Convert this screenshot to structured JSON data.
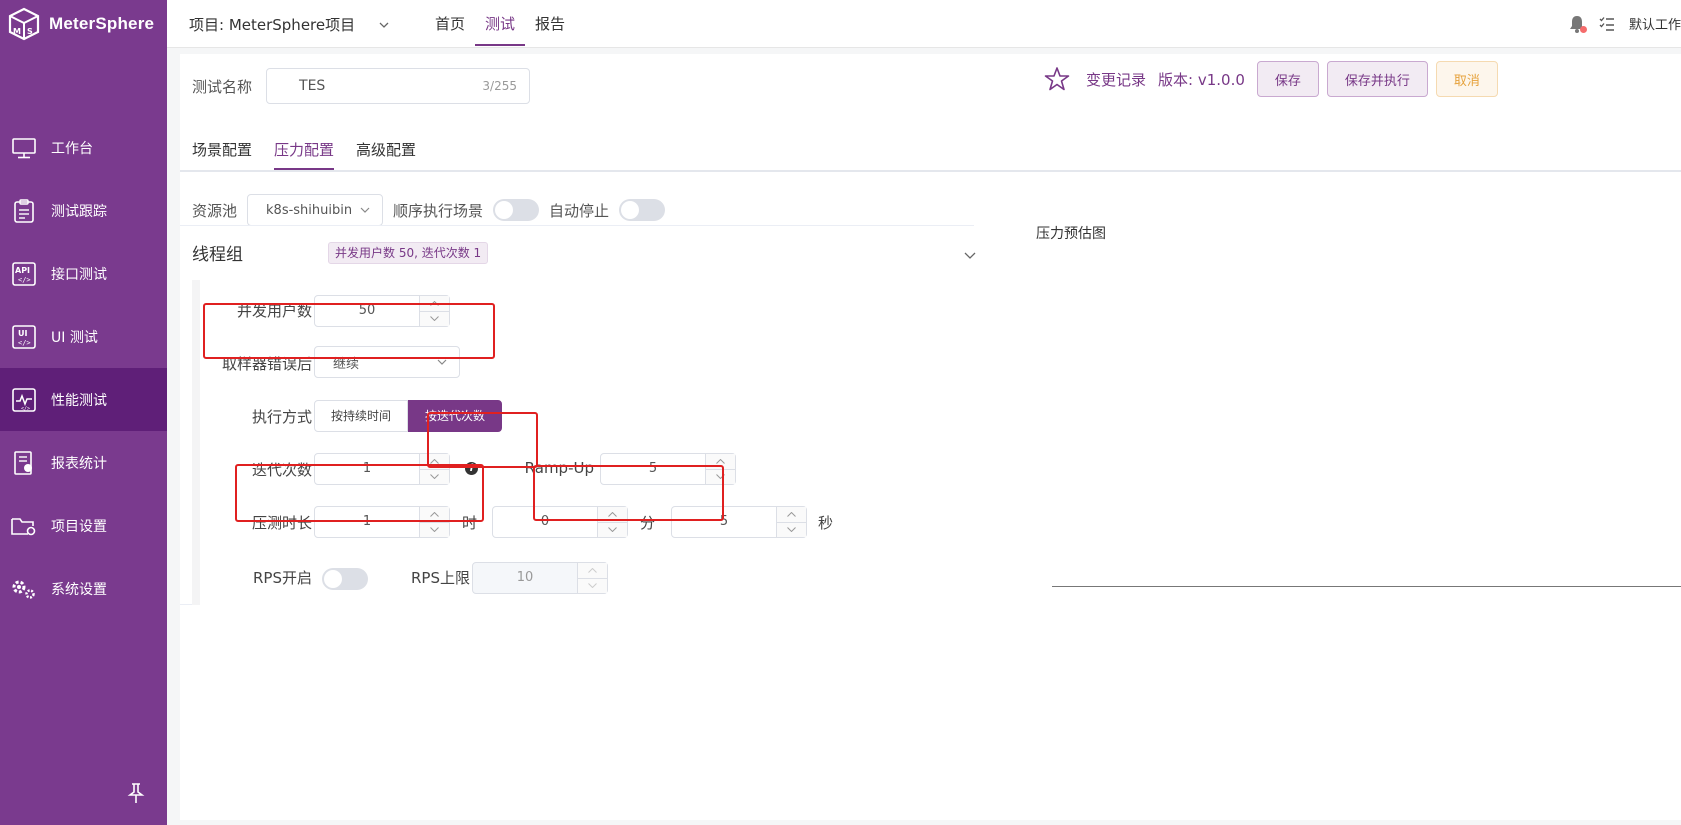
{
  "app": {
    "logo_text": "MeterSphere",
    "logo_icon": "metersphere-cube-icon",
    "accent": "#783887",
    "sidebar_bg": "#7a3a8e"
  },
  "sidebar": {
    "items": [
      {
        "label": "工作台",
        "icon": "monitor-icon"
      },
      {
        "label": "测试跟踪",
        "icon": "clipboard-icon"
      },
      {
        "label": "接口测试",
        "icon": "api-icon"
      },
      {
        "label": "UI 测试",
        "icon": "ui-icon"
      },
      {
        "label": "性能测试",
        "icon": "performance-chart-icon",
        "active": true
      },
      {
        "label": "报表统计",
        "icon": "report-icon"
      },
      {
        "label": "项目设置",
        "icon": "folder-gear-icon"
      },
      {
        "label": "系统设置",
        "icon": "gears-icon"
      }
    ],
    "pin_icon": "pin-icon"
  },
  "topbar": {
    "project": "项目: MeterSphere项目",
    "tabs": [
      "首页",
      "测试",
      "报告"
    ],
    "active_tab": "测试",
    "workspace": "默认工作"
  },
  "form": {
    "name_label": "测试名称",
    "name_value": "TES",
    "name_count": "3/255",
    "changelog": "变更记录",
    "version": "版本: v1.0.0",
    "save": "保存",
    "save_run": "保存并执行",
    "cancel": "取消"
  },
  "tabs": [
    "场景配置",
    "压力配置",
    "高级配置"
  ],
  "active_tab": "压力配置",
  "pool": {
    "label": "资源池",
    "value": "k8s-shihuibin",
    "serial_label": "顺序执行场景",
    "serial_on": false,
    "autostop_label": "自动停止",
    "autostop_on": false
  },
  "thread_group": {
    "title": "线程组",
    "summary": "并发用户数 50, 迭代次数 1",
    "users_label": "并发用户数",
    "users": "50",
    "on_error_label": "取样器错误后",
    "on_error": "继续",
    "mode_label": "执行方式",
    "mode_duration": "按持续时间",
    "mode_iterations": "按迭代次数",
    "iter_label": "迭代次数",
    "iterations": "1",
    "rampup_label": "Ramp-Up",
    "rampup": "5",
    "duration_label": "压测时长",
    "hours": "1",
    "hours_unit": "时",
    "minutes": "0",
    "minutes_unit": "分",
    "seconds": "5",
    "seconds_unit": "秒",
    "rps_label": "RPS开启",
    "rps_on": false,
    "rps_limit_label": "RPS上限",
    "rps_limit": "10"
  },
  "chart": {
    "title": "压力预估图"
  }
}
